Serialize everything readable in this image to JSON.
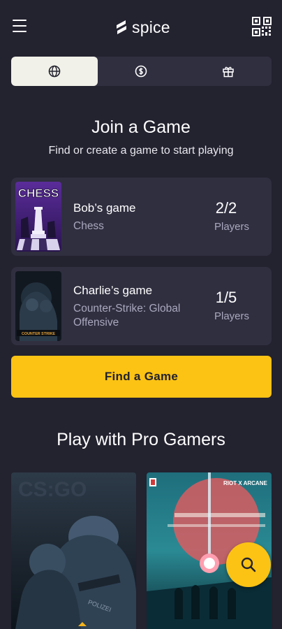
{
  "header": {
    "brand": "spice",
    "menu_icon": "hamburger-menu-icon",
    "qr_icon": "qr-code-icon"
  },
  "tabs": [
    {
      "icon": "globe-icon",
      "active": true
    },
    {
      "icon": "dollar-coin-icon",
      "active": false
    },
    {
      "icon": "gift-icon",
      "active": false
    }
  ],
  "join": {
    "title": "Join a Game",
    "subtitle": "Find or create a game to start playing"
  },
  "games": [
    {
      "name": "Bob’s game",
      "title": "Chess",
      "count": "2/2",
      "count_label": "Players",
      "thumb_text": "CHESS"
    },
    {
      "name": "Charlie’s game",
      "title": "Counter-Strike: Global Offensive",
      "count": "1/5",
      "count_label": "Players",
      "thumb_text": "COUNTER STRIKE"
    }
  ],
  "find_button": "Find a Game",
  "pro": {
    "title": "Play with Pro Gamers",
    "cards": [
      {
        "game": "Counter-Strike",
        "overlay": "POLIZEI"
      },
      {
        "game": "Arcane",
        "overlay": "RIOT X ARCANE"
      }
    ]
  },
  "colors": {
    "background": "#23222f",
    "card": "#302f40",
    "accent": "#fcc314",
    "muted_text": "#a9a8bd"
  },
  "fab_icon": "search-icon"
}
